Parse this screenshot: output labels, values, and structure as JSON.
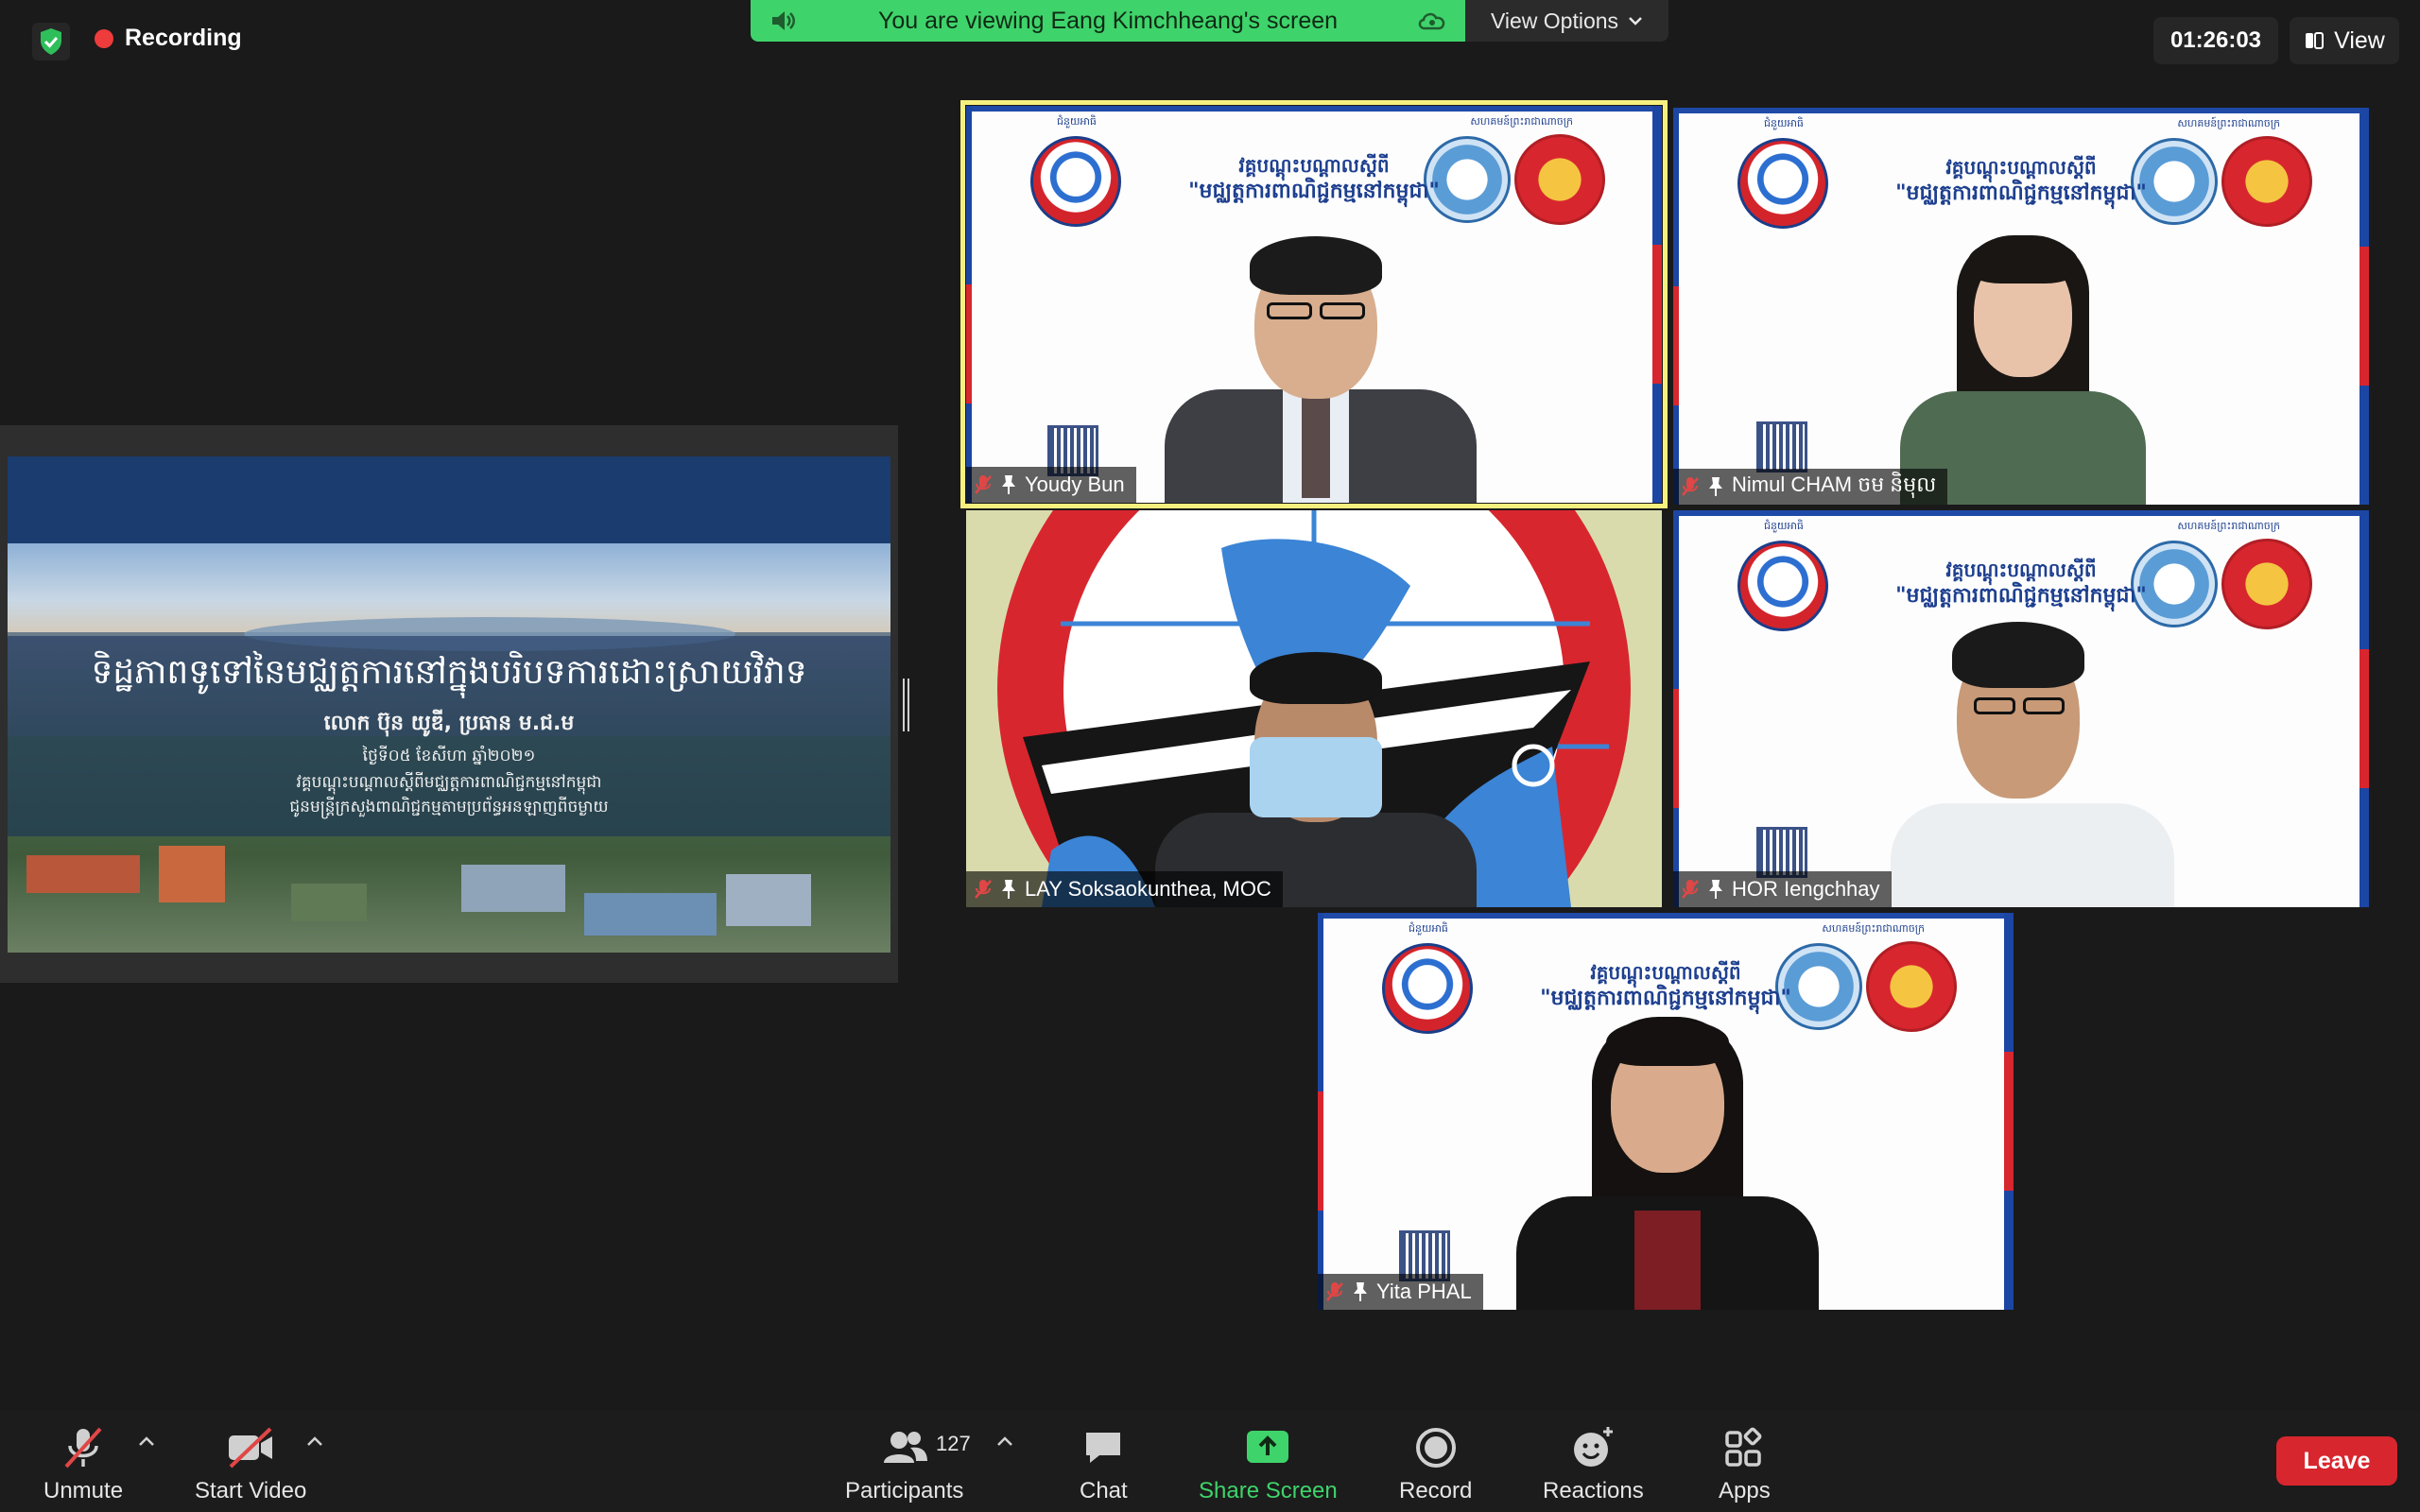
{
  "topbar": {
    "recording_label": "Recording",
    "viewing_text": "You are viewing Eang Kimchheang's screen",
    "view_options_label": "View Options",
    "timer": "01:26:03",
    "view_label": "View"
  },
  "shared_slide": {
    "title": "ទិដ្ឋភាពទូទៅនៃមជ្ឈត្តការនៅក្នុងបរិបទការដោះស្រាយវិវាទ",
    "speaker": "លោក ប៊ុន យូឌី, ប្រធាន ម.ជ.ម",
    "date": "ថ្ងៃទី០៥ ខែសីហា ឆ្នាំ២០២១",
    "event": "វគ្គបណ្តុះបណ្តាលស្តីពីមជ្ឈត្តការពាណិជ្ជកម្មនៅកម្ពុជា",
    "organizer": "ជូនមន្ត្រីក្រសួងពាណិជ្ជកម្មតាមប្រព័ន្ធអនឡាញពីចម្ងាយ"
  },
  "banner": {
    "line1": "វគ្គបណ្តុះបណ្តាលស្តីពី",
    "line2": "\"មជ្ឈត្តការពាណិជ្ជកម្មនៅកម្ពុជា\"",
    "tiny_left": "ជំនួយអាធិ",
    "tiny_right": "សហគមន៍ព្រះរាជាណាចក្រ"
  },
  "participants": [
    {
      "name": "Youdy Bun"
    },
    {
      "name": "Nimul CHAM ចម និមុល"
    },
    {
      "name": "LAY Soksaokunthea, MOC"
    },
    {
      "name": "HOR Iengchhay"
    },
    {
      "name": "Yita PHAL"
    }
  ],
  "toolbar": {
    "unmute": "Unmute",
    "start_video": "Start Video",
    "participants": "Participants",
    "participant_count": "127",
    "chat": "Chat",
    "share_screen": "Share Screen",
    "record": "Record",
    "reactions": "Reactions",
    "apps": "Apps",
    "leave": "Leave"
  },
  "colors": {
    "accent_green": "#3fd36b",
    "leave_red": "#d8262e",
    "active_speaker": "#f6f17f"
  }
}
